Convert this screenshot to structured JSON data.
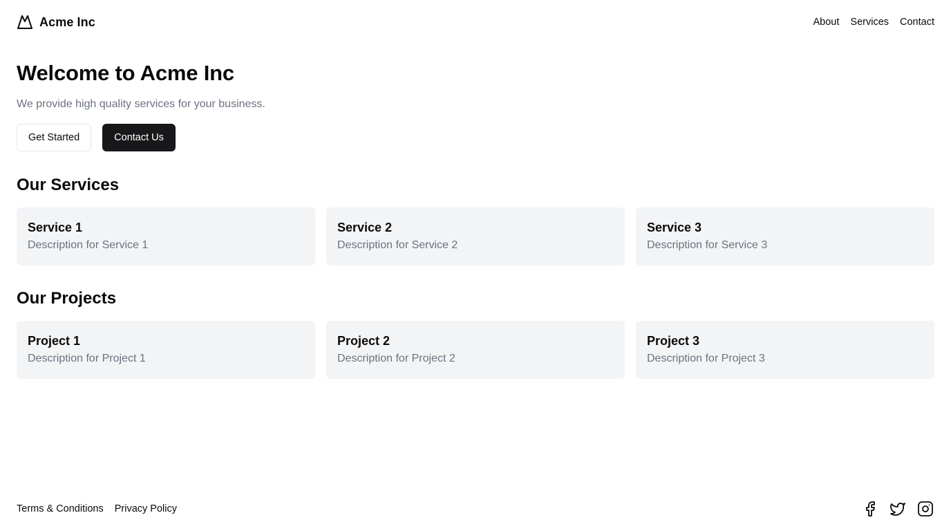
{
  "header": {
    "brand_name": "Acme Inc",
    "brand_icon": "mountain-icon",
    "nav": [
      {
        "label": "About"
      },
      {
        "label": "Services"
      },
      {
        "label": "Contact"
      }
    ]
  },
  "hero": {
    "title": "Welcome to Acme Inc",
    "subtitle": "We provide high quality services for your business.",
    "primary_button": "Get Started",
    "secondary_button": "Contact Us"
  },
  "services": {
    "heading": "Our Services",
    "items": [
      {
        "title": "Service 1",
        "description": "Description for Service 1"
      },
      {
        "title": "Service 2",
        "description": "Description for Service 2"
      },
      {
        "title": "Service 3",
        "description": "Description for Service 3"
      }
    ]
  },
  "projects": {
    "heading": "Our Projects",
    "items": [
      {
        "title": "Project 1",
        "description": "Description for Project 1"
      },
      {
        "title": "Project 2",
        "description": "Description for Project 2"
      },
      {
        "title": "Project 3",
        "description": "Description for Project 3"
      }
    ]
  },
  "footer": {
    "links": [
      {
        "label": "Terms & Conditions"
      },
      {
        "label": "Privacy Policy"
      }
    ],
    "social": [
      {
        "icon": "facebook-icon"
      },
      {
        "icon": "twitter-icon"
      },
      {
        "icon": "instagram-icon"
      }
    ]
  },
  "colors": {
    "text": "#0a0a0a",
    "muted": "#6b7280",
    "card_bg": "#f3f4f6",
    "button_dark": "#18181b",
    "border": "#e5e7eb"
  }
}
